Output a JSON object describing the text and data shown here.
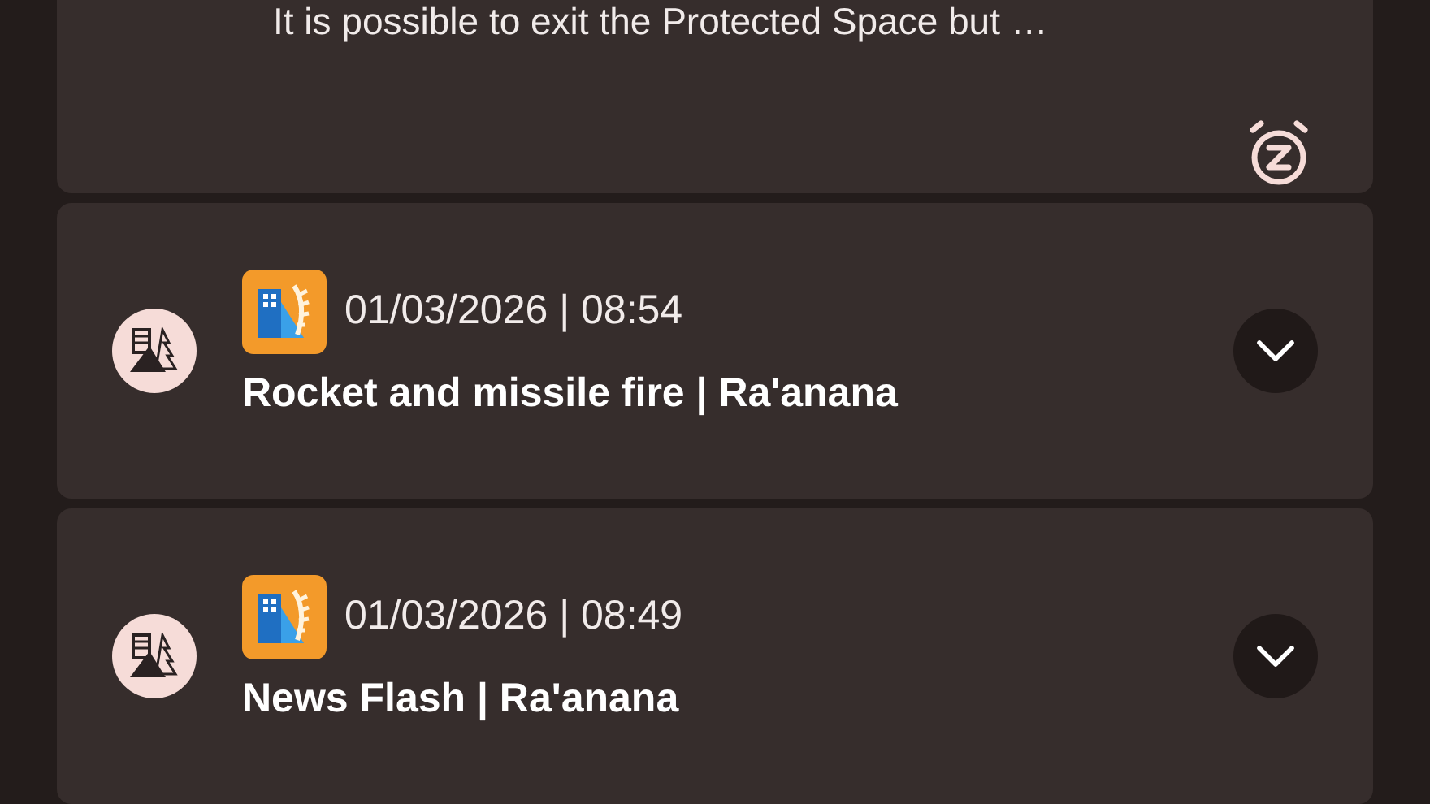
{
  "notice": {
    "text": "It is possible to exit the Protected Space but …"
  },
  "alerts": [
    {
      "date_time": "01/03/2026 | 08:54",
      "title": "Rocket and missile fire | Ra'anana",
      "expanded": false
    },
    {
      "date_time": "01/03/2026 | 08:49",
      "title": "News Flash | Ra'anana",
      "expanded": false
    }
  ]
}
